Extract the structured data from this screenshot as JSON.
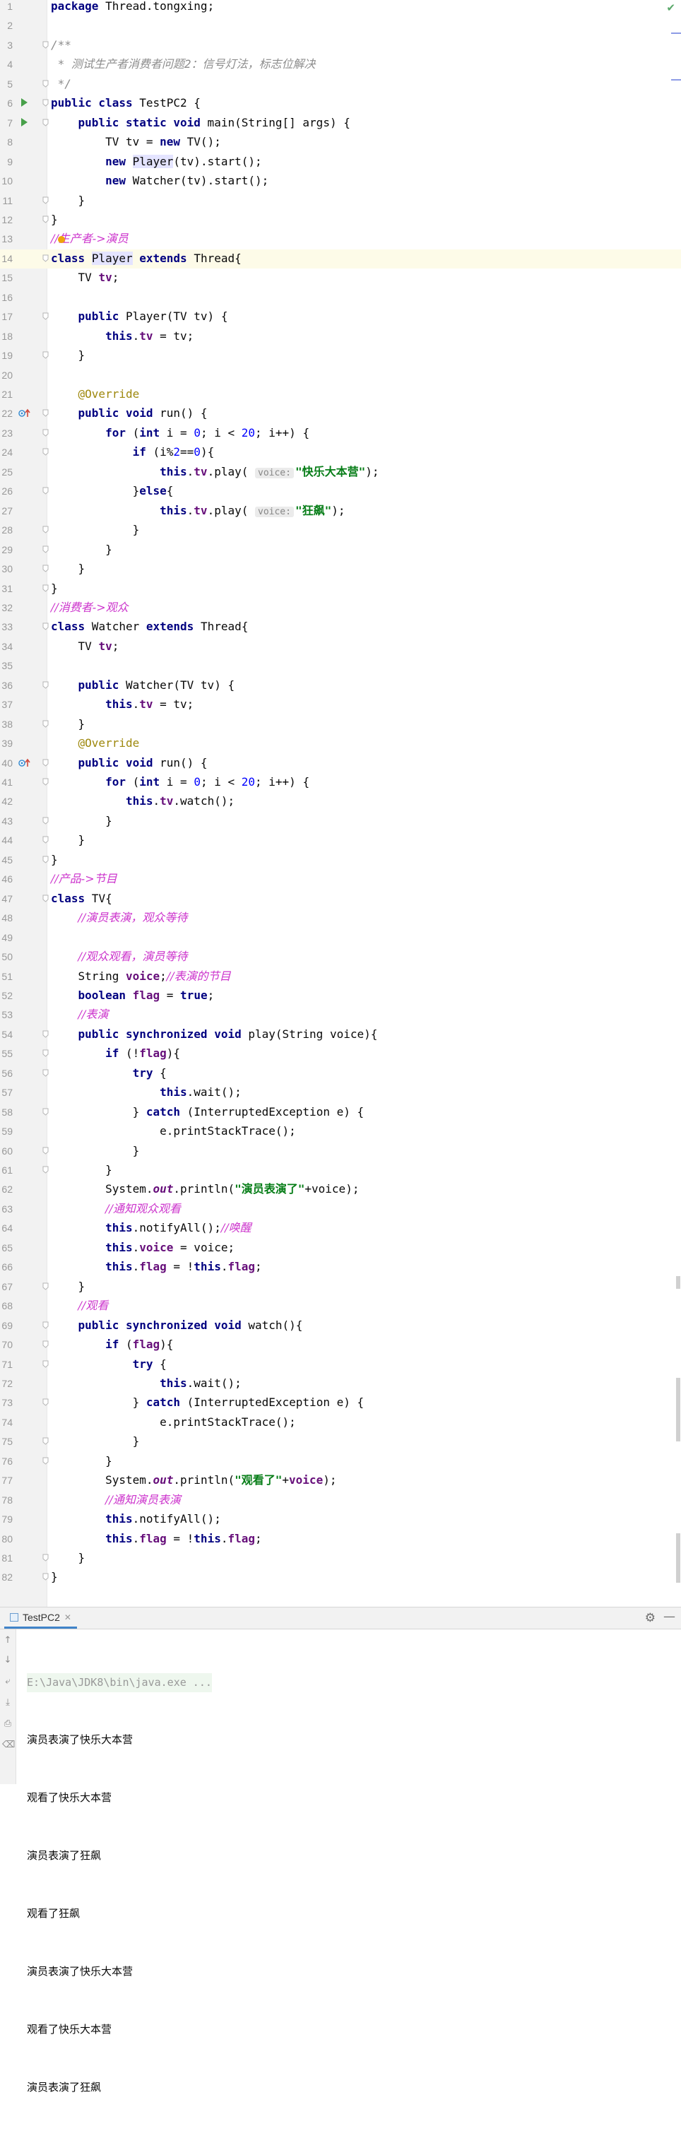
{
  "editor": {
    "lines": [
      {
        "n": "1",
        "html": "<span class=\"kw\">package</span> Thread.tongxing;"
      },
      {
        "n": "2",
        "html": ""
      },
      {
        "n": "3",
        "html": "<span class=\"jd\">/**</span>"
      },
      {
        "n": "4",
        "html": "<span class=\"jd\"> * 测试生产者消费者问题2：信号灯法，标志位解决</span>"
      },
      {
        "n": "5",
        "html": "<span class=\"jd\"> */</span>"
      },
      {
        "n": "6",
        "html": "<span class=\"kw\">public class</span> TestPC2 {"
      },
      {
        "n": "7",
        "html": "    <span class=\"kw\">public static void</span> main(String[] args) {"
      },
      {
        "n": "8",
        "html": "        TV tv = <span class=\"kw\">new</span> TV();"
      },
      {
        "n": "9",
        "html": "        <span class=\"kw\">new</span> <span class=\"selword\">Player</span>(tv).start();"
      },
      {
        "n": "10",
        "html": "        <span class=\"kw\">new</span> Watcher(tv).start();"
      },
      {
        "n": "11",
        "html": "    }"
      },
      {
        "n": "12",
        "html": "}"
      },
      {
        "n": "13",
        "html": "<span class=\"cm\">//生产者-&gt;演员</span>"
      },
      {
        "n": "14",
        "html": "<span class=\"kw\">class</span> <span class=\"selword\">Player</span> <span class=\"kw\">extends</span> Thread{"
      },
      {
        "n": "15",
        "html": "    TV <span class=\"fld\">tv</span>;"
      },
      {
        "n": "16",
        "html": ""
      },
      {
        "n": "17",
        "html": "    <span class=\"kw\">public</span> Player(TV tv) {"
      },
      {
        "n": "18",
        "html": "        <span class=\"kw\">this</span>.<span class=\"fld\">tv</span> = tv;"
      },
      {
        "n": "19",
        "html": "    }"
      },
      {
        "n": "20",
        "html": ""
      },
      {
        "n": "21",
        "html": "    <span class=\"an\">@Override</span>"
      },
      {
        "n": "22",
        "html": "    <span class=\"kw\">public void</span> run() {"
      },
      {
        "n": "23",
        "html": "        <span class=\"kw\">for</span> (<span class=\"kw\">int</span> i = <span class=\"lt\">0</span>; i &lt; <span class=\"lt\">20</span>; i++) {"
      },
      {
        "n": "24",
        "html": "            <span class=\"kw\">if</span> (i%<span class=\"lt\">2</span>==<span class=\"lt\">0</span>){"
      },
      {
        "n": "25",
        "html": "                <span class=\"kw\">this</span>.<span class=\"fld\">tv</span>.play( <span class=\"hint\">voice:</span><span class=\"str\">\"快乐大本营\"</span>);"
      },
      {
        "n": "26",
        "html": "            }<span class=\"kw\">else</span>{"
      },
      {
        "n": "27",
        "html": "                <span class=\"kw\">this</span>.<span class=\"fld\">tv</span>.play( <span class=\"hint\">voice:</span><span class=\"str\">\"狂飙\"</span>);"
      },
      {
        "n": "28",
        "html": "            }"
      },
      {
        "n": "29",
        "html": "        }"
      },
      {
        "n": "30",
        "html": "    }"
      },
      {
        "n": "31",
        "html": "}"
      },
      {
        "n": "32",
        "html": "<span class=\"cm\">//消费者-&gt;观众</span>"
      },
      {
        "n": "33",
        "html": "<span class=\"kw\">class</span> Watcher <span class=\"kw\">extends</span> Thread{"
      },
      {
        "n": "34",
        "html": "    TV <span class=\"fld\">tv</span>;"
      },
      {
        "n": "35",
        "html": ""
      },
      {
        "n": "36",
        "html": "    <span class=\"kw\">public</span> Watcher(TV tv) {"
      },
      {
        "n": "37",
        "html": "        <span class=\"kw\">this</span>.<span class=\"fld\">tv</span> = tv;"
      },
      {
        "n": "38",
        "html": "    }"
      },
      {
        "n": "39",
        "html": "    <span class=\"an\">@Override</span>"
      },
      {
        "n": "40",
        "html": "    <span class=\"kw\">public void</span> run() {"
      },
      {
        "n": "41",
        "html": "        <span class=\"kw\">for</span> (<span class=\"kw\">int</span> i = <span class=\"lt\">0</span>; i &lt; <span class=\"lt\">20</span>; i++) {"
      },
      {
        "n": "42",
        "html": "           <span class=\"kw\">this</span>.<span class=\"fld\">tv</span>.watch();"
      },
      {
        "n": "43",
        "html": "        }"
      },
      {
        "n": "44",
        "html": "    }"
      },
      {
        "n": "45",
        "html": "}"
      },
      {
        "n": "46",
        "html": "<span class=\"cm\">//产品-&gt;节目</span>"
      },
      {
        "n": "47",
        "html": "<span class=\"kw\">class</span> TV{"
      },
      {
        "n": "48",
        "html": "    <span class=\"cm\">//演员表演，观众等待</span>"
      },
      {
        "n": "49",
        "html": ""
      },
      {
        "n": "50",
        "html": "    <span class=\"cm\">//观众观看，演员等待</span>"
      },
      {
        "n": "51",
        "html": "    String <span class=\"fld\">voice</span>;<span class=\"cm\">//表演的节目</span>"
      },
      {
        "n": "52",
        "html": "    <span class=\"kw\">boolean</span> <span class=\"fld\">flag</span> = <span class=\"kw\">true</span>;"
      },
      {
        "n": "53",
        "html": "    <span class=\"cm\">//表演</span>"
      },
      {
        "n": "54",
        "html": "    <span class=\"kw\">public synchronized void</span> play(String voice){"
      },
      {
        "n": "55",
        "html": "        <span class=\"kw\">if</span> (!<span class=\"fld\">flag</span>){"
      },
      {
        "n": "56",
        "html": "            <span class=\"kw\">try</span> {"
      },
      {
        "n": "57",
        "html": "                <span class=\"kw\">this</span>.wait();"
      },
      {
        "n": "58",
        "html": "            } <span class=\"kw\">catch</span> (InterruptedException e) {"
      },
      {
        "n": "59",
        "html": "                e.printStackTrace();"
      },
      {
        "n": "60",
        "html": "            }"
      },
      {
        "n": "61",
        "html": "        }"
      },
      {
        "n": "62",
        "html": "        System.<span class=\"st\">out</span>.println(<span class=\"str\">\"演员表演了\"</span>+voice);"
      },
      {
        "n": "63",
        "html": "        <span class=\"cm\">//通知观众观看</span>"
      },
      {
        "n": "64",
        "html": "        <span class=\"kw\">this</span>.notifyAll();<span class=\"cm\">//唤醒</span>"
      },
      {
        "n": "65",
        "html": "        <span class=\"kw\">this</span>.<span class=\"fld\">voice</span> = voice;"
      },
      {
        "n": "66",
        "html": "        <span class=\"kw\">this</span>.<span class=\"fld\">flag</span> = !<span class=\"kw\">this</span>.<span class=\"fld\">flag</span>;"
      },
      {
        "n": "67",
        "html": "    }"
      },
      {
        "n": "68",
        "html": "    <span class=\"cm\">//观看</span>"
      },
      {
        "n": "69",
        "html": "    <span class=\"kw\">public synchronized void</span> watch(){"
      },
      {
        "n": "70",
        "html": "        <span class=\"kw\">if</span> (<span class=\"fld\">flag</span>){"
      },
      {
        "n": "71",
        "html": "            <span class=\"kw\">try</span> {"
      },
      {
        "n": "72",
        "html": "                <span class=\"kw\">this</span>.wait();"
      },
      {
        "n": "73",
        "html": "            } <span class=\"kw\">catch</span> (InterruptedException e) {"
      },
      {
        "n": "74",
        "html": "                e.printStackTrace();"
      },
      {
        "n": "75",
        "html": "            }"
      },
      {
        "n": "76",
        "html": "        }"
      },
      {
        "n": "77",
        "html": "        System.<span class=\"st\">out</span>.println(<span class=\"str\">\"观看了\"</span>+<span class=\"fld\">voice</span>);"
      },
      {
        "n": "78",
        "html": "        <span class=\"cm\">//通知演员表演</span>"
      },
      {
        "n": "79",
        "html": "        <span class=\"kw\">this</span>.notifyAll();"
      },
      {
        "n": "80",
        "html": "        <span class=\"kw\">this</span>.<span class=\"fld\">flag</span> = !<span class=\"kw\">this</span>.<span class=\"fld\">flag</span>;"
      },
      {
        "n": "81",
        "html": "    }"
      },
      {
        "n": "82",
        "html": "}"
      }
    ]
  },
  "run_panel": {
    "tab_label": "TestPC2",
    "command": "E:\\Java\\JDK8\\bin\\java.exe ...",
    "output": [
      "演员表演了快乐大本营",
      "观看了快乐大本营",
      "演员表演了狂飙",
      "观看了狂飙",
      "演员表演了快乐大本营",
      "观看了快乐大本营",
      "演员表演了狂飙"
    ]
  },
  "colors": {
    "keyword": "#000080",
    "string": "#067d17",
    "comment": "#cc33cc",
    "field": "#660e7a",
    "annotation": "#9e880d",
    "run_icon": "#48a04a"
  },
  "icons": [
    "checkmark-icon",
    "run-gutter-icon",
    "override-gutter-icon",
    "fold-icon",
    "settings-gear-icon",
    "minimize-icon",
    "close-tab-icon"
  ]
}
